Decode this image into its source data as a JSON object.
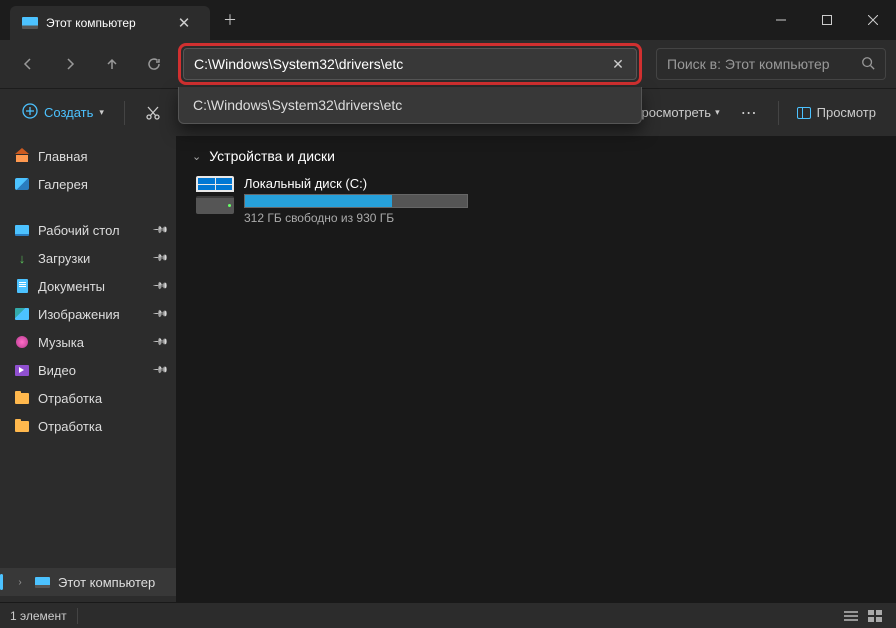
{
  "tab": {
    "title": "Этот компьютер"
  },
  "address": {
    "value": "C:\\Windows\\System32\\drivers\\etc",
    "suggestion": "C:\\Windows\\System32\\drivers\\etc"
  },
  "search": {
    "placeholder": "Поиск в: Этот компьютер"
  },
  "toolbar": {
    "new_label": "Создать",
    "view_label": "Просмотреть",
    "more": "⋯",
    "preview_label": "Просмотр"
  },
  "sidebar": {
    "top": [
      {
        "label": "Главная",
        "icon": "home"
      },
      {
        "label": "Галерея",
        "icon": "gallery"
      }
    ],
    "quick": [
      {
        "label": "Рабочий стол",
        "icon": "desktop",
        "pinned": true
      },
      {
        "label": "Загрузки",
        "icon": "download",
        "pinned": true
      },
      {
        "label": "Документы",
        "icon": "doc",
        "pinned": true
      },
      {
        "label": "Изображения",
        "icon": "img",
        "pinned": true
      },
      {
        "label": "Музыка",
        "icon": "music",
        "pinned": true
      },
      {
        "label": "Видео",
        "icon": "video",
        "pinned": true
      },
      {
        "label": "Отработка",
        "icon": "folder",
        "pinned": false
      },
      {
        "label": "Отработка",
        "icon": "folder",
        "pinned": false
      }
    ],
    "bottom": [
      {
        "label": "Этот компьютер",
        "icon": "pc",
        "selected": true,
        "expandable": true
      }
    ]
  },
  "content": {
    "group_header": "Устройства и диски",
    "drives": [
      {
        "name": "Локальный диск (C:)",
        "free_text": "312 ГБ свободно из 930 ГБ",
        "fill_pct": 66
      }
    ]
  },
  "status": {
    "count": "1 элемент"
  }
}
